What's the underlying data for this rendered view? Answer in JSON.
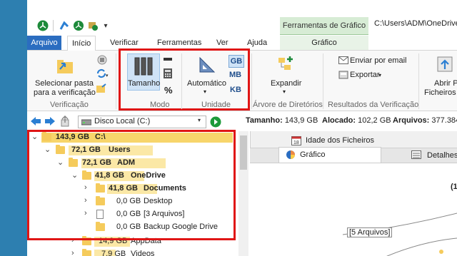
{
  "title": {
    "tools_tab": "Ferramentas de Gráfico",
    "path": "C:\\Users\\ADM\\OneDrive"
  },
  "tabs": {
    "file": "Arquivo",
    "home": "Início",
    "verify": "Verificar",
    "tools": "Ferramentas",
    "view": "Ver",
    "help": "Ajuda",
    "chart": "Gráfico"
  },
  "ribbon": {
    "select_folder": "Selecionar pasta",
    "select_folder_2": "para a verificação",
    "group_verify": "Verificação",
    "size_button": "Tamanho",
    "percent": "%",
    "group_mode": "Modo",
    "automatic": "Automático",
    "unit_gb": "GB",
    "unit_mb": "MB",
    "unit_kb": "KB",
    "group_unit": "Unidade",
    "expand": "Expandir",
    "group_tree": "Árvore de Diretórios",
    "email": "Enviar por email",
    "export": "Exportar",
    "group_results": "Resultados da Verificação",
    "open_files": "Abrir P",
    "open_files_2": "Ficheiros e"
  },
  "address": {
    "disk": "Disco Local (C:)"
  },
  "info": {
    "size_label": "Tamanho:",
    "size_value": "143,9 GB",
    "alloc_label": "Alocado:",
    "alloc_value": "102,2 GB",
    "files_label": "Arquivos:",
    "files_value": "377.384"
  },
  "tree": [
    {
      "size": "143,9 GB",
      "name": "C:\\",
      "bold": true
    },
    {
      "size": "72,1 GB",
      "name": "Users",
      "bold": true
    },
    {
      "size": "72,1 GB",
      "name": "ADM",
      "bold": true
    },
    {
      "size": "41,8 GB",
      "name": "OneDrive",
      "bold": true
    },
    {
      "size": "41,8 GB",
      "name": "Documents",
      "bold": true
    },
    {
      "size": "0,0 GB",
      "name": "Desktop",
      "bold": false
    },
    {
      "size": "0,0 GB",
      "name": "[3 Arquivos]",
      "bold": false
    },
    {
      "size": "0,0 GB",
      "name": "Backup Google Drive",
      "bold": false
    },
    {
      "size": "14,9 GB",
      "name": "AppData",
      "bold": false
    },
    {
      "size": "7,9 GB",
      "name": "Videos",
      "bold": false
    }
  ],
  "right_pane": {
    "tab_age": "Idade dos Ficheiros",
    "tab_chart": "Gráfico",
    "tab_details": "Detalhes",
    "callout": "[5 Arquivos]",
    "paren": "(1"
  },
  "colors": {
    "accent": "#2b6dc0",
    "highlight_red": "#e01515",
    "folder_bar": "#fbe8a6",
    "tools_green": "#d7ecd5"
  }
}
